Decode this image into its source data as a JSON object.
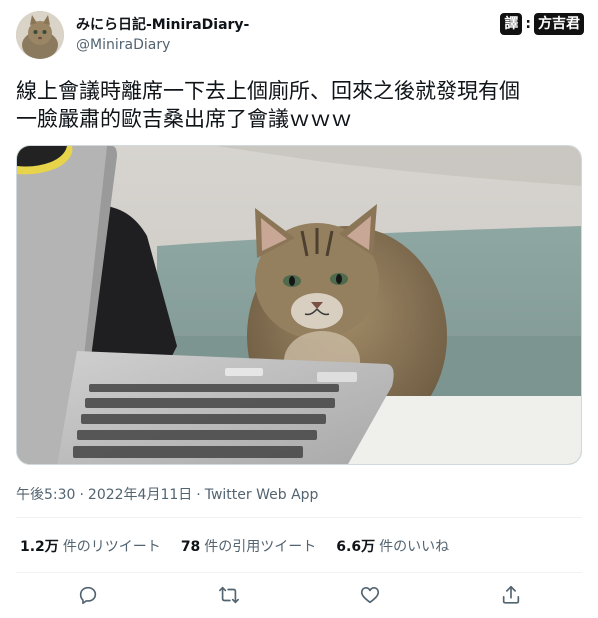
{
  "user": {
    "display_name": "みにら日記-MiniraDiary-",
    "handle": "@MiniraDiary"
  },
  "credit": {
    "label1": "譯",
    "separator": ":",
    "label2": "方吉君"
  },
  "tweet": {
    "text": "線上會議時離席一下去上個廁所、回來之後就發現有個\n一臉嚴肅的歐吉桑出席了會議ｗｗｗ"
  },
  "meta": {
    "time": "午後5:30",
    "date": "2022年4月11日",
    "separator": "·",
    "source": "Twitter Web App"
  },
  "stats": [
    {
      "num": "1.2万",
      "label": "件のリツイート"
    },
    {
      "num": "78",
      "label": "件の引用ツイート"
    },
    {
      "num": "6.6万",
      "label": "件のいいね"
    }
  ],
  "actions": {
    "reply_icon": "reply-icon",
    "retweet_icon": "retweet-icon",
    "like_icon": "heart-icon",
    "share_icon": "share-icon"
  },
  "colors": {
    "text": "#0f1419",
    "secondary": "#536471",
    "divider": "#eff3f4",
    "icon": "#536471"
  }
}
